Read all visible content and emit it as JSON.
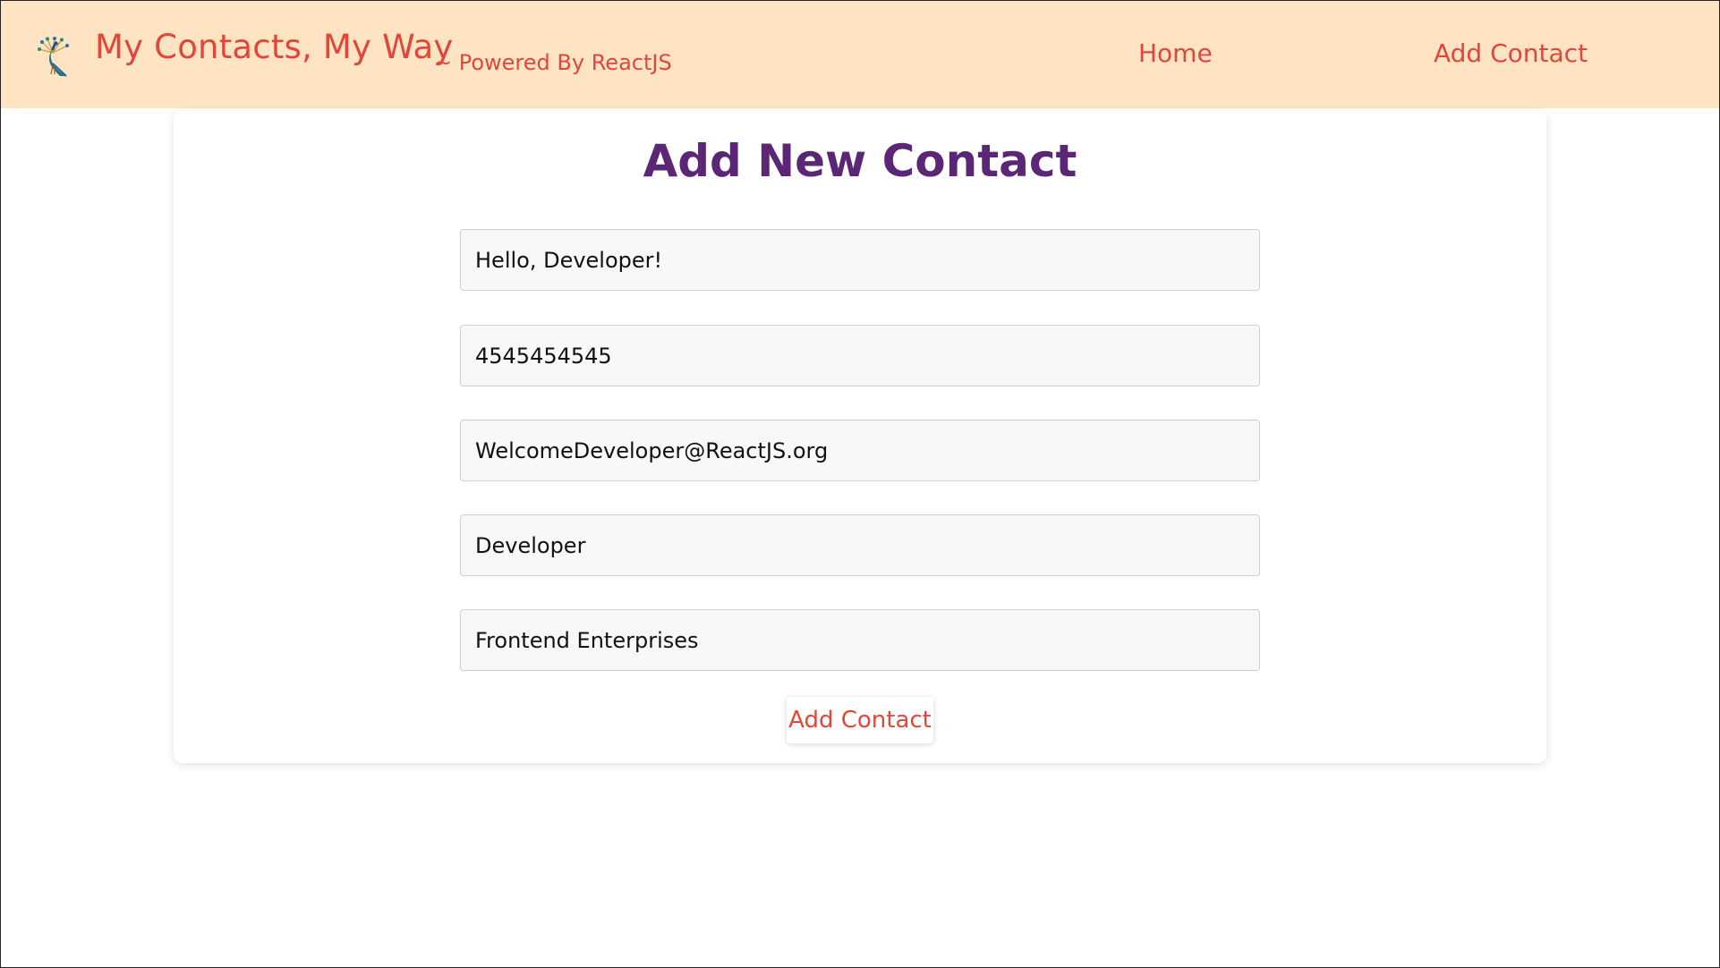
{
  "header": {
    "logo_icon": "peacock-icon",
    "title": "My Contacts, My Way",
    "subtitle": "~ Powered By ReactJS",
    "nav": [
      {
        "label": "Home"
      },
      {
        "label": "Add Contact"
      }
    ]
  },
  "form": {
    "title": "Add New Contact",
    "fields": [
      {
        "value": "Hello, Developer!"
      },
      {
        "value": "4545454545"
      },
      {
        "value": "WelcomeDeveloper@ReactJS.org"
      },
      {
        "value": "Developer"
      },
      {
        "value": "Frontend Enterprises"
      }
    ],
    "submit_label": "Add Contact"
  },
  "colors": {
    "header_bg": "#ffe4c3",
    "accent": "#e0473a",
    "title": "#5b2676"
  }
}
